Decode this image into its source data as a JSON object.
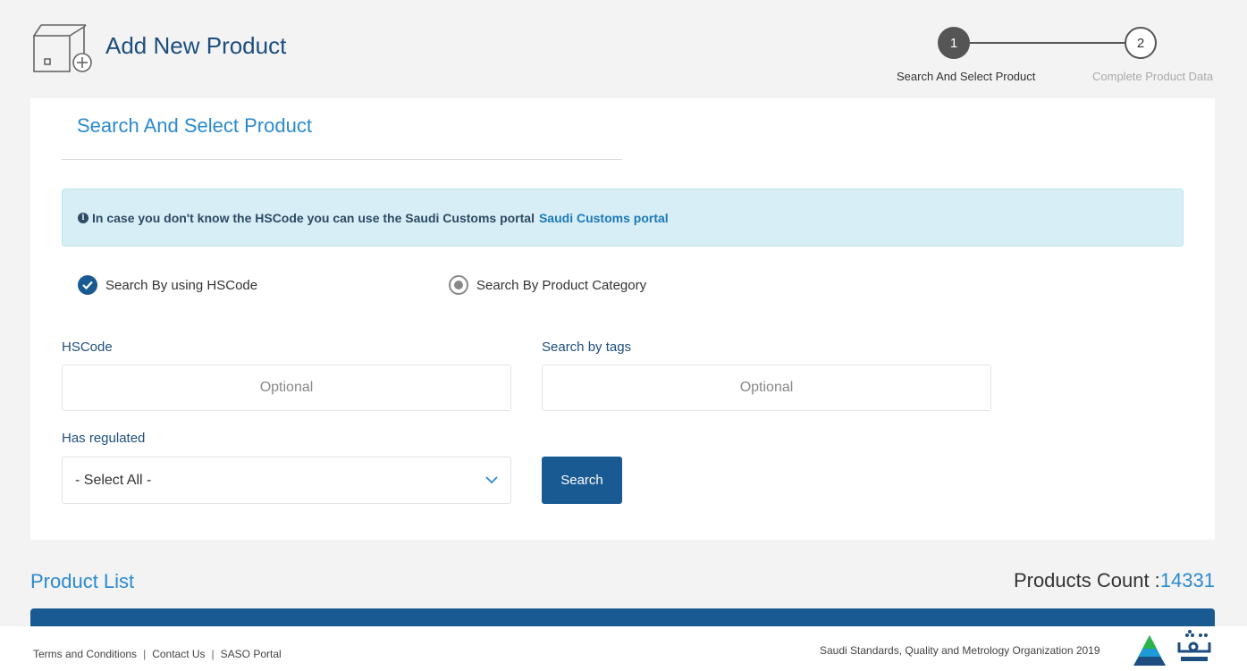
{
  "header": {
    "title": "Add New Product",
    "icon": "box-add-icon"
  },
  "stepper": {
    "steps": [
      {
        "number": "1",
        "label": "Search And Select Product",
        "active": true
      },
      {
        "number": "2",
        "label": "Complete Product Data",
        "active": false
      }
    ]
  },
  "search_panel": {
    "title": "Search And Select Product",
    "alert": {
      "text": "In case you don't know the HSCode you can use the Saudi Customs portal",
      "link_text": "Saudi Customs portal"
    },
    "radios": [
      {
        "label": "Search By using HSCode",
        "selected": true
      },
      {
        "label": "Search By Product Category",
        "selected": false
      }
    ],
    "fields": {
      "hscode": {
        "label": "HSCode",
        "placeholder": "Optional",
        "value": ""
      },
      "tags": {
        "label": "Search by tags",
        "placeholder": "Optional",
        "value": ""
      },
      "regulated": {
        "label": "Has regulated",
        "value": "- Select All -"
      }
    },
    "search_button": "Search"
  },
  "product_list": {
    "title": "Product List",
    "count_label": "Products Count :",
    "count_value": "14331"
  },
  "footer": {
    "links": [
      "Terms and Conditions",
      "Contact Us",
      "SASO Portal"
    ],
    "copyright": "Saudi Standards, Quality and Metrology Organization  2019",
    "logos": [
      "saso-logo",
      "thiqah-logo"
    ]
  },
  "colors": {
    "primary": "#1a5a93",
    "accent": "#2a8ad0",
    "alert_bg": "#d7eef6"
  }
}
